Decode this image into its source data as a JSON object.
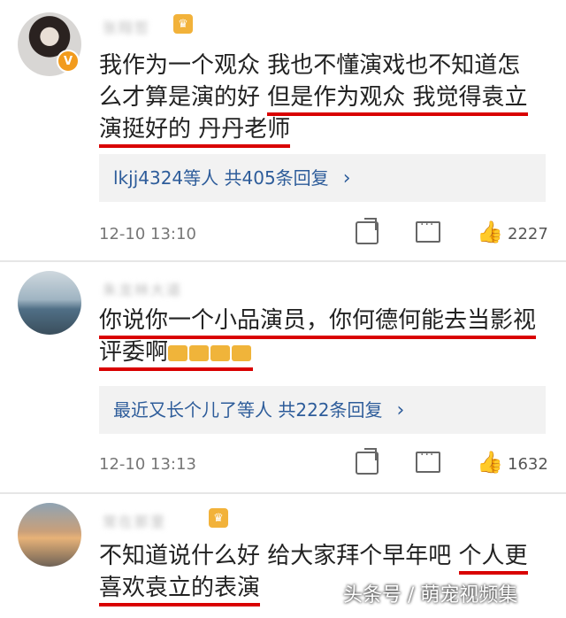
{
  "comments": [
    {
      "username": "张翔哲",
      "verified": "V",
      "text_lines": [
        "我作为一个观众 我也不懂演戏也不知道怎",
        "么才算是演的好 ",
        "但是作为观众 我觉得袁立",
        "演挺好的 丹丹老师"
      ],
      "reply_summary": "lkjj4324等人  共405条回复",
      "time": "12-10 13:10",
      "likes": "2227"
    },
    {
      "username": "朱龙林大道",
      "text_lines": [
        "你说你一个小品演员，你何德何能去当影视",
        "评委啊"
      ],
      "reply_summary": "最近又长个儿了等人  共222条回复",
      "time": "12-10 13:13",
      "likes": "1632"
    },
    {
      "username": "常在那里",
      "text_lines": [
        "不知道说什么好  给大家拜个早年吧 ",
        "个人更",
        "喜欢袁立的表演"
      ]
    }
  ],
  "watermark": "头条号 / 萌宠视频集",
  "icons": [
    "share-icon",
    "comment-icon",
    "like-icon",
    "chevron-right-icon"
  ],
  "colors": {
    "underline": "#d90000",
    "link": "#2d5c9a",
    "badge": "#f29b1d"
  }
}
